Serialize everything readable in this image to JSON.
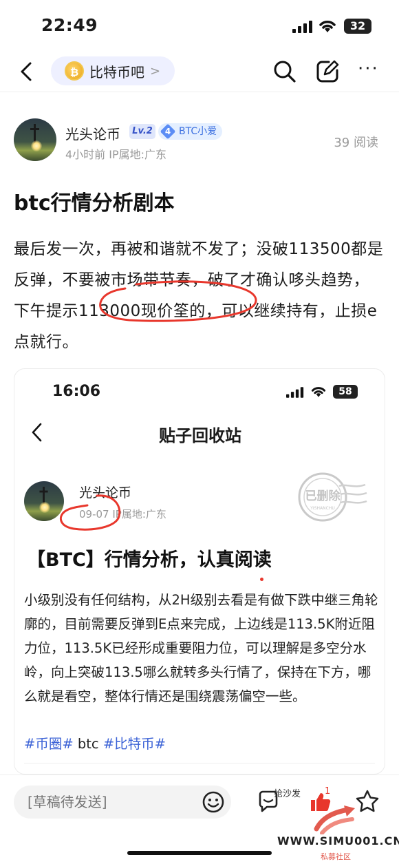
{
  "status_bar": {
    "time": "22:49",
    "battery": "32"
  },
  "nav": {
    "forum_name": "比特币吧",
    "forum_coin": "₿",
    "chip_arrow": ">",
    "more": "···"
  },
  "author": {
    "name": "光头论币",
    "level": "Lv.2",
    "fan_level": "4",
    "fan_badge": "BTC小爱",
    "meta": "4小时前 IP属地:广东",
    "reads": "39 阅读"
  },
  "post": {
    "title": "btc行情分析剧本",
    "body": "最后发一次，再被和谐就不发了；没破113500都是反弹，不要被市场带节奏，破了才确认哆头趋势，下午提示113000现价筌的，可以继续持有，止损e点就行。"
  },
  "embedded_screenshot": {
    "time": "16:06",
    "battery": "58",
    "page_title": "贴子回收站",
    "author_name": "光头论币",
    "meta": "09-07 IP属地:广东",
    "stamp_text": "已删除",
    "stamp_sub": "YISHANCHU",
    "post_title": "【BTC】行情分析，认真阅读",
    "body": "小级别没有任何结构，从2H级别去看是有做下跌中继三角轮廓的，目前需要反弹到E点来完成，上边线是113.5K附近阻力位，113.5K已经形成重要阻力位，可以理解是多空分水岭，向上突破113.5哪么就转多头行情了，保持在下方，哪么就是看空，整体行情还是围绕震荡偏空一些。",
    "tags": [
      "#币圈#",
      " btc ",
      "#比特币#"
    ]
  },
  "bottom_bar": {
    "draft_placeholder": "[草稿待发送]",
    "sofa_label": "抢沙发",
    "like_count": "1"
  },
  "watermark": {
    "url": "WWW.SIMU001.CN",
    "sub": "私募社区"
  },
  "colors": {
    "accent_blue": "#3b62d6",
    "annotation_red": "#e8372c",
    "chip_bg": "#eef0ff"
  },
  "icons": [
    "signal-icon",
    "wifi-icon",
    "battery-icon",
    "back-icon",
    "coin-icon",
    "search-icon",
    "edit-icon",
    "more-icon",
    "emoji-icon",
    "comment-icon",
    "like-icon",
    "star-icon"
  ]
}
